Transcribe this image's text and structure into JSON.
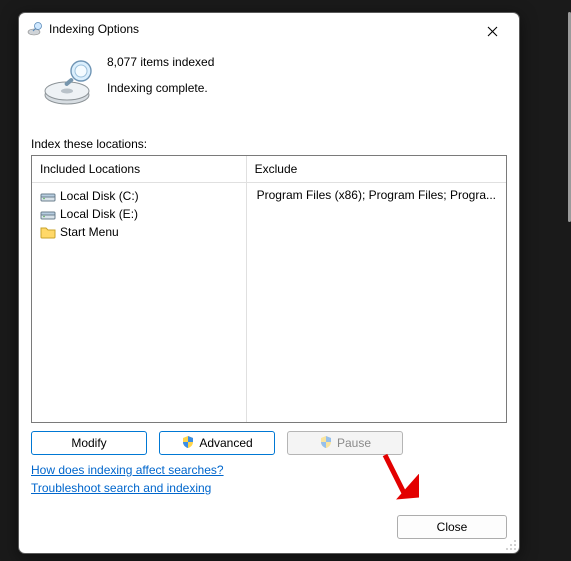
{
  "window": {
    "title": "Indexing Options"
  },
  "status": {
    "count_text": "8,077 items indexed",
    "state_text": "Indexing complete."
  },
  "locations_label": "Index these locations:",
  "columns": {
    "included": "Included Locations",
    "excluded": "Exclude"
  },
  "included_items": [
    {
      "icon": "drive",
      "label": "Local Disk (C:)"
    },
    {
      "icon": "drive",
      "label": "Local Disk (E:)"
    },
    {
      "icon": "folder",
      "label": "Start Menu"
    }
  ],
  "excluded_items": [
    "Program Files (x86); Program Files; Progra..."
  ],
  "buttons": {
    "modify": "Modify",
    "advanced": "Advanced",
    "pause": "Pause",
    "close": "Close"
  },
  "links": {
    "how": "How does indexing affect searches?",
    "troubleshoot": "Troubleshoot search and indexing"
  }
}
